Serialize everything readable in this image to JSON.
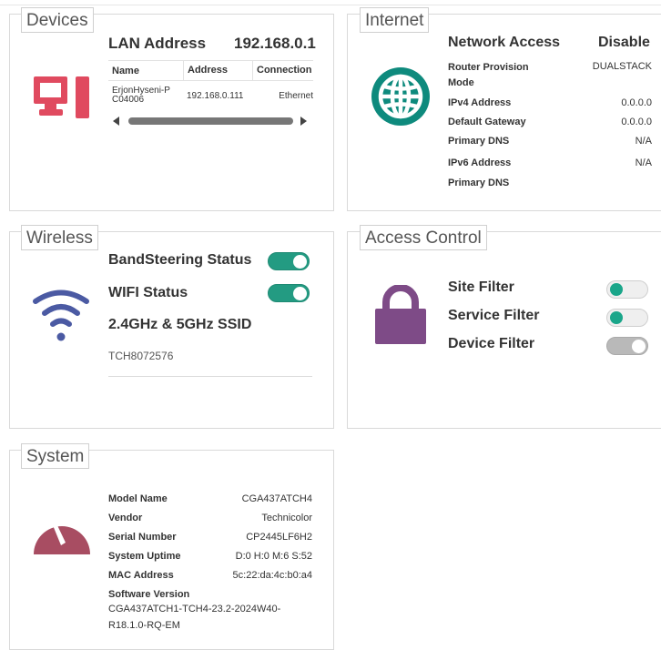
{
  "devices": {
    "title": "Devices",
    "lan_label": "LAN Address",
    "lan_value": "192.168.0.1",
    "columns": [
      "Name",
      "Address",
      "Connection"
    ],
    "rows": [
      {
        "name_line1": "ErjonHyseni-P",
        "name_line2": "C04006",
        "address": "192.168.0.111",
        "connection": "Ethernet"
      }
    ],
    "icon": "monitor-icon",
    "icon_color": "#e04a5f"
  },
  "internet": {
    "title": "Internet",
    "network_access_label": "Network Access",
    "network_access_value": "Disable",
    "router_provision_label": "Router Provision Mode",
    "router_provision_value": "DUALSTACK",
    "ipv4_label": "IPv4 Address",
    "ipv4_value": "0.0.0.0",
    "gateway_label": "Default Gateway",
    "gateway_value": "0.0.0.0",
    "dns1_label": "Primary DNS",
    "dns1_value": "N/A",
    "ipv6_label": "IPv6 Address",
    "ipv6_value": "N/A",
    "dns2_label": "Primary DNS",
    "icon": "globe-icon",
    "icon_color": "#0e8a7d"
  },
  "wireless": {
    "title": "Wireless",
    "bandsteering_label": "BandSteering Status",
    "bandsteering_on": true,
    "wifi_label": "WIFI Status",
    "wifi_on": true,
    "ssid_label": "2.4GHz & 5GHz SSID",
    "ssid_value": "TCH8072576",
    "icon": "wifi-icon",
    "icon_color": "#4b5aa3"
  },
  "access_control": {
    "title": "Access Control",
    "site_filter_label": "Site Filter",
    "site_filter_on": true,
    "service_filter_label": "Service Filter",
    "service_filter_on": true,
    "device_filter_label": "Device Filter",
    "device_filter_on": false,
    "icon": "lock-icon",
    "icon_color": "#7e4b87"
  },
  "system": {
    "title": "System",
    "model_label": "Model Name",
    "model_value": "CGA437ATCH4",
    "vendor_label": "Vendor",
    "vendor_value": "Technicolor",
    "serial_label": "Serial Number",
    "serial_value": "CP2445LF6H2",
    "uptime_label": "System Uptime",
    "uptime_value": "D:0 H:0 M:6 S:52",
    "mac_label": "MAC Address",
    "mac_value": "5c:22:da:4c:b0:a4",
    "software_label": "Software Version",
    "software_value_line1": "CGA437ATCH1-TCH4-23.2-2024W40-",
    "software_value_line2": "R18.1.0-RQ-EM",
    "icon": "gauge-icon",
    "icon_color": "#a84d62"
  }
}
